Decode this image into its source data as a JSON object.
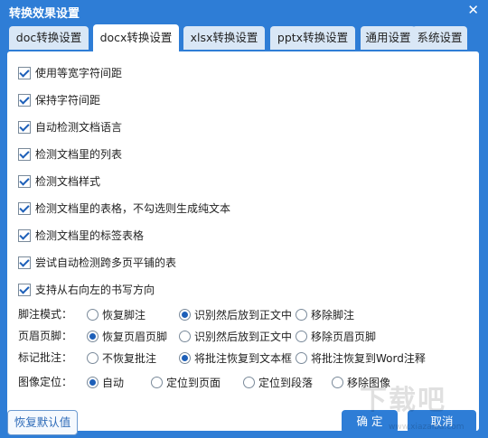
{
  "window": {
    "title": "转换效果设置",
    "close_glyph": "✕"
  },
  "tabs": [
    {
      "label": "doc转换设置",
      "active": false
    },
    {
      "label": "docx转换设置",
      "active": true
    },
    {
      "label": "xlsx转换设置",
      "active": false
    },
    {
      "label": "pptx转换设置",
      "active": false
    },
    {
      "label": "通用设置",
      "active": false
    },
    {
      "label": "系统设置",
      "active": false
    }
  ],
  "options": [
    {
      "label": "使用等宽字符间距",
      "checked": true
    },
    {
      "label": "保持字符间距",
      "checked": true
    },
    {
      "label": "自动检测文档语言",
      "checked": true
    },
    {
      "label": "检测文档里的列表",
      "checked": true
    },
    {
      "label": "检测文档样式",
      "checked": true
    },
    {
      "label": "检测文档里的表格，不勾选则生成纯文本",
      "checked": true
    },
    {
      "label": "检测文档里的标签表格",
      "checked": true
    },
    {
      "label": "尝试自动检测跨多页平铺的表",
      "checked": true
    },
    {
      "label": "支持从右向左的书写方向",
      "checked": true
    }
  ],
  "radio_groups": [
    {
      "label": "脚注模式：",
      "options": [
        "恢复脚注",
        "识别然后放到正文中",
        "移除脚注"
      ],
      "selected": 1
    },
    {
      "label": "页眉页脚：",
      "options": [
        "恢复页眉页脚",
        "识别然后放到正文中",
        "移除页眉页脚"
      ],
      "selected": 0
    },
    {
      "label": "标记批注：",
      "options": [
        "不恢复批注",
        "将批注恢复到文本框",
        "将批注恢复到Word注释"
      ],
      "selected": 1
    },
    {
      "label": "图像定位：",
      "options": [
        "自动",
        "定位到页面",
        "定位到段落",
        "移除图像"
      ],
      "selected": 0
    }
  ],
  "buttons": {
    "reset": "恢复默认值",
    "ok": "确 定",
    "cancel": "取消"
  },
  "watermark": {
    "text": "下载吧",
    "sub": "www.xiazaiba.com"
  },
  "colors": {
    "accent": "#2e7dd6",
    "tab_inactive": "#d9e7f6",
    "check": "#1d5fb8"
  }
}
